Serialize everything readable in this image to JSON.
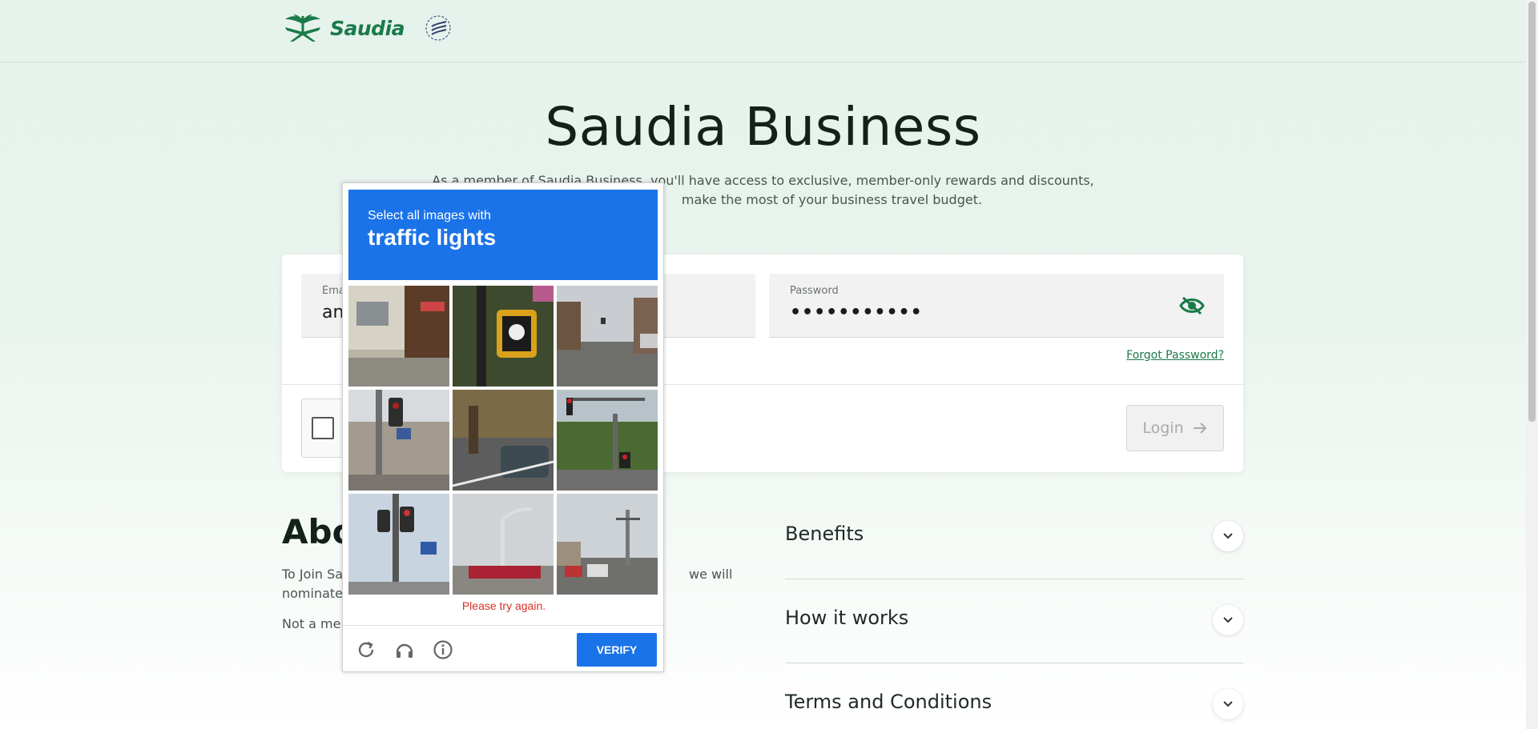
{
  "header": {
    "logo_text": "Saudia",
    "alliance_logo_text": "SKYTEAM"
  },
  "hero": {
    "title": "Saudia Business",
    "intro_line1": "As a member of Saudia Business, you'll have access to exclusive, member-only rewards and discounts,",
    "intro_line2": "make the most of your business travel budget."
  },
  "login": {
    "email_label": "Ema",
    "email_value": "an",
    "password_label": "Password",
    "password_value": "•••••••••••",
    "forgot_label": "Forgot Password?",
    "login_label": "Login"
  },
  "about": {
    "title": "Abo",
    "line1_start": "To Join Sa",
    "line1_end": "we will",
    "line2": "nominate",
    "line3": "Not a mem"
  },
  "accordion": {
    "items": [
      {
        "label": "Benefits"
      },
      {
        "label": "How it works"
      },
      {
        "label": "Terms and Conditions"
      }
    ]
  },
  "captcha": {
    "instruction": "Select all images with",
    "object": "traffic lights",
    "error": "Please try again.",
    "verify_label": "VERIFY"
  },
  "colors": {
    "brand_green": "#1a7a4a",
    "captcha_blue": "#1a73e8",
    "error_red": "#d93025"
  }
}
